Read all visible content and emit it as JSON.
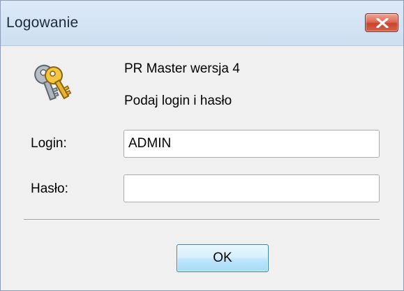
{
  "window": {
    "title": "Logowanie",
    "close_icon": "close-icon"
  },
  "header": {
    "icon": "keys-icon",
    "app_name": "PR Master wersja 4",
    "instruction": "Podaj login i hasło"
  },
  "form": {
    "login_label": "Login:",
    "login_value": "ADMIN",
    "password_label": "Hasło:",
    "password_value": ""
  },
  "buttons": {
    "ok_label": "OK"
  },
  "colors": {
    "titlebar": "#cddff2",
    "close_button": "#c8452f",
    "dialog_background": "#f0f0f0",
    "ok_button": "#bee6fd"
  }
}
